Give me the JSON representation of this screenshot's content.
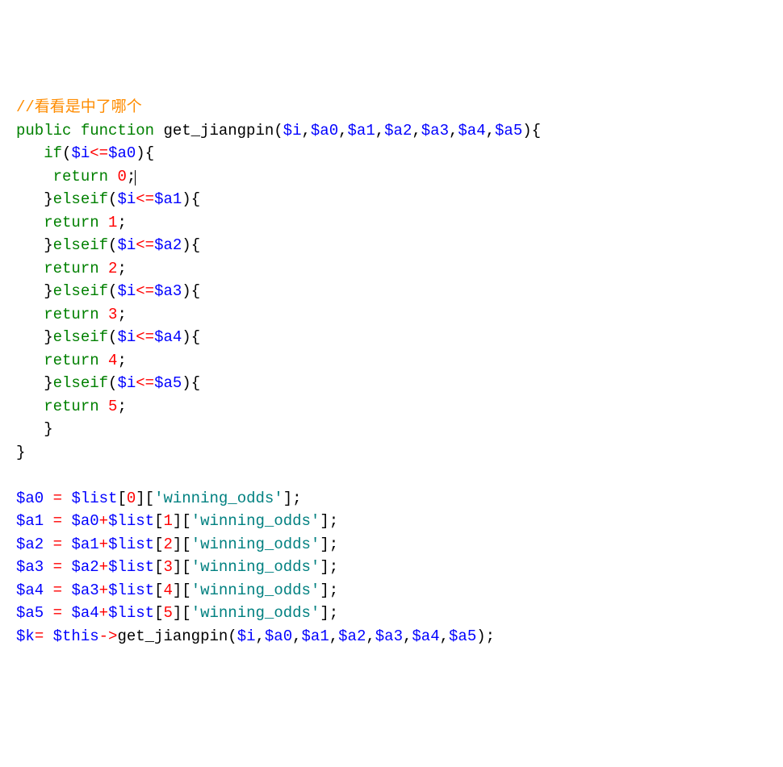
{
  "comment": "//看看是中了哪个",
  "fn_sig_prefix": "public function ",
  "fn_name": "get_jiangpin",
  "params": [
    "$i",
    "$a0",
    "$a1",
    "$a2",
    "$a3",
    "$a4",
    "$a5"
  ],
  "if_kw": "if",
  "elseif_kw": "elseif",
  "return_kw": "return",
  "ret_vals": [
    "0",
    "1",
    "2",
    "3",
    "4",
    "5"
  ],
  "branches": [
    {
      "lhs": "$i",
      "op": "<=",
      "rhs": "$a0",
      "ret": "0"
    },
    {
      "lhs": "$i",
      "op": "<=",
      "rhs": "$a1",
      "ret": "1"
    },
    {
      "lhs": "$i",
      "op": "<=",
      "rhs": "$a2",
      "ret": "2"
    },
    {
      "lhs": "$i",
      "op": "<=",
      "rhs": "$a3",
      "ret": "3"
    },
    {
      "lhs": "$i",
      "op": "<=",
      "rhs": "$a4",
      "ret": "4"
    },
    {
      "lhs": "$i",
      "op": "<=",
      "rhs": "$a5",
      "ret": "5"
    }
  ],
  "list_var": "$list",
  "key_winning": "'winning_odds'",
  "assigns": [
    {
      "lhs": "$a0",
      "rhs_var": "$list",
      "idx": "0",
      "key": "'winning_odds'",
      "prefix": null
    },
    {
      "lhs": "$a1",
      "rhs_var": "$list",
      "idx": "1",
      "key": "'winning_odds'",
      "prefix": "$a0"
    },
    {
      "lhs": "$a2",
      "rhs_var": "$list",
      "idx": "2",
      "key": "'winning_odds'",
      "prefix": "$a1"
    },
    {
      "lhs": "$a3",
      "rhs_var": "$list",
      "idx": "3",
      "key": "'winning_odds'",
      "prefix": "$a2"
    },
    {
      "lhs": "$a4",
      "rhs_var": "$list",
      "idx": "4",
      "key": "'winning_odds'",
      "prefix": "$a3"
    },
    {
      "lhs": "$a5",
      "rhs_var": "$list",
      "idx": "5",
      "key": "'winning_odds'",
      "prefix": "$a4"
    }
  ],
  "call_lhs": "$k",
  "call_this": "$this",
  "call_arrow": "->",
  "call_fn": "get_jiangpin",
  "call_args": [
    "$i",
    "$a0",
    "$a1",
    "$a2",
    "$a3",
    "$a4",
    "$a5"
  ],
  "eq": " = ",
  "plus": "+",
  "semi": ";",
  "open_paren": "(",
  "close_paren": ")",
  "open_brace": "{",
  "close_brace": "}",
  "open_bracket": "[",
  "close_bracket": "]",
  "comma": ","
}
